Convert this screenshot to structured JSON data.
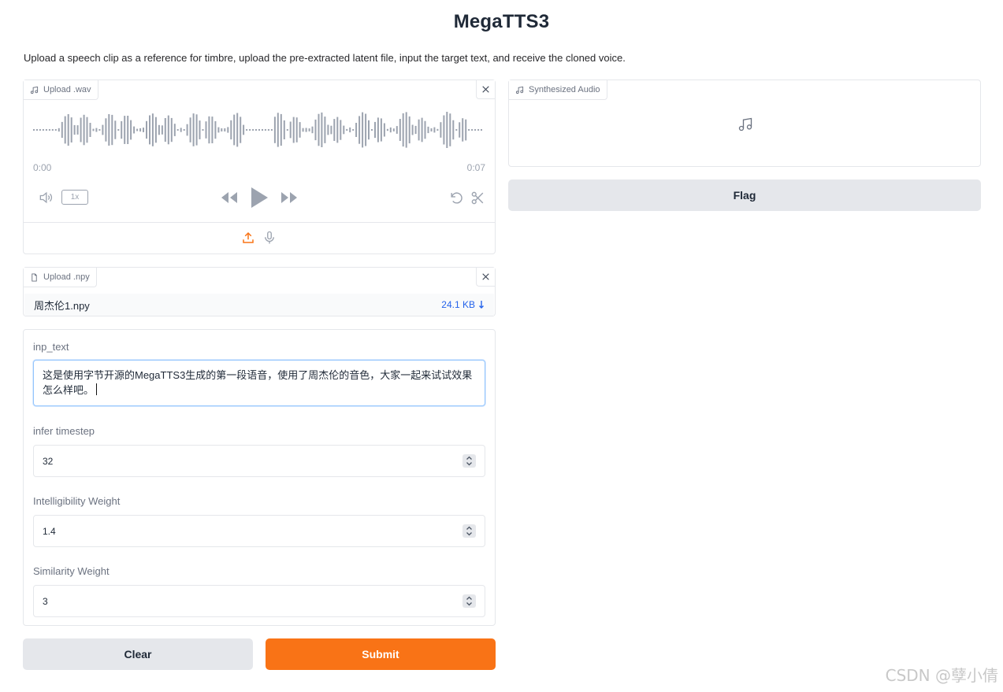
{
  "app": {
    "title": "MegaTTS3",
    "description": "Upload a speech clip as a reference for timbre, upload the pre-extracted latent file, input the target text, and receive the cloned voice."
  },
  "audio_input": {
    "label": "Upload .wav",
    "time_start": "0:00",
    "time_end": "0:07",
    "speed": "1x",
    "icons": [
      "music-note-icon",
      "close-icon",
      "volume-icon",
      "rewind-icon",
      "play-icon",
      "fast-forward-icon",
      "undo-icon",
      "scissors-icon",
      "upload-icon",
      "microphone-icon"
    ]
  },
  "npy_input": {
    "label": "Upload .npy",
    "file_name": "周杰伦1.npy",
    "file_size": "24.1 KB"
  },
  "inp_text": {
    "label": "inp_text",
    "value": "这是使用字节开源的MegaTTS3生成的第一段语音，使用了周杰伦的音色，大家一起来试试效果怎么样吧。"
  },
  "infer_timestep": {
    "label": "infer timestep",
    "value": "32"
  },
  "intelligibility_weight": {
    "label": "Intelligibility Weight",
    "value": "1.4"
  },
  "similarity_weight": {
    "label": "Similarity Weight",
    "value": "3"
  },
  "buttons": {
    "clear": "Clear",
    "submit": "Submit",
    "flag": "Flag"
  },
  "output": {
    "label": "Synthesized Audio"
  },
  "colors": {
    "accent": "#f97316",
    "link": "#2563eb",
    "border": "#e5e7eb"
  },
  "watermark": "CSDN @孽小倩"
}
